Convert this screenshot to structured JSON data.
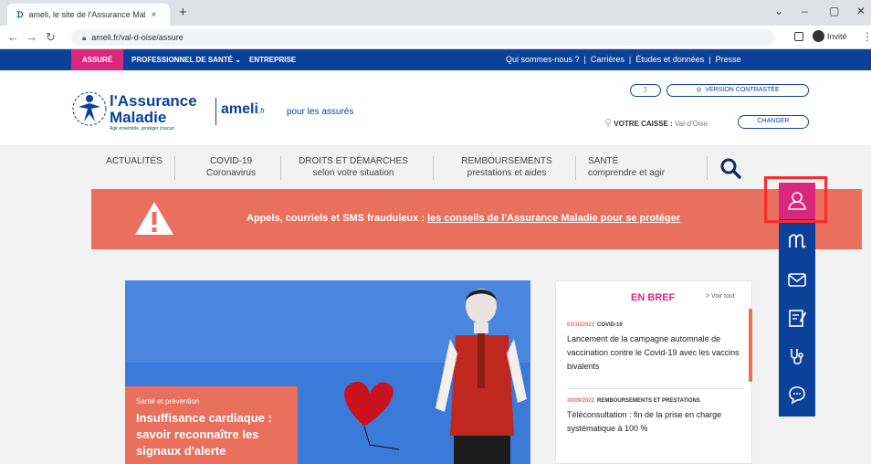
{
  "browser": {
    "tab_title": "ameli, le site de l'Assurance Mala",
    "tab_close": "×",
    "new_tab": "+",
    "url": "ameli.fr/val-d-oise/assure",
    "profile_label": "Invité",
    "window_controls": [
      "⌄",
      "–",
      "▢",
      "✕"
    ]
  },
  "topnav": {
    "assure": "ASSURÉ",
    "professionnel": "PROFESSIONNEL DE SANTÉ ⌄",
    "entreprise": "ENTREPRISE",
    "links": [
      "Qui sommes-nous ?",
      "Carrières",
      "Études et données",
      "Presse"
    ]
  },
  "header": {
    "logo_line1": "l'Assurance",
    "logo_line2": "Maladie",
    "logo_tagline": "Agir ensemble, protéger chacun",
    "ameli": "ameli",
    "ameli_fr": ".fr",
    "pour_assures": "pour les assurés",
    "contrast_label": "VERSION CONTRASTÉE",
    "caisse_label": "VOTRE CAISSE :",
    "caisse_value": "Val-d'Oise",
    "change_label": "CHANGER"
  },
  "mainnav": [
    {
      "line1": "ACTUALITÉS",
      "line2": ""
    },
    {
      "line1": "COVID-19",
      "line2": "Coronavirus"
    },
    {
      "line1": "DROITS ET DÉMARCHES",
      "line2": "selon votre situation"
    },
    {
      "line1": "REMBOURSEMENTS",
      "line2": "prestations et aides"
    },
    {
      "line1": "SANTÉ",
      "line2": "comprendre et agir"
    }
  ],
  "alert": {
    "prefix": "Appels, courriels et SMS frauduleux :",
    "link": "les conseils de l'Assurance Maladie pour se protéger"
  },
  "sidebar_icons": [
    "user-icon",
    "ameli-m-icon",
    "mail-icon",
    "form-icon",
    "stethoscope-icon",
    "chat-icon"
  ],
  "hero": {
    "category": "Santé et prévention",
    "title": "Insuffisance cardiaque : savoir reconnaître les signaux d'alerte"
  },
  "bref": {
    "title": "EN BREF",
    "more": "> Voir tout",
    "items": [
      {
        "date": "03/10/2022",
        "tag": "COVID-19",
        "text": "Lancement de la campagne automnale de vaccination contre le Covid-19 avec les vaccins bivalents"
      },
      {
        "date": "30/09/2022",
        "tag": "REMBOURSEMENTS ET PRESTATIONS",
        "text": "Téléconsultation : fin de la prise en charge systématique à 100 %"
      }
    ]
  },
  "colors": {
    "navy": "#0c419a",
    "pink": "#d8277c",
    "coral": "#e8705c",
    "highlight": "#ff2a2a"
  }
}
